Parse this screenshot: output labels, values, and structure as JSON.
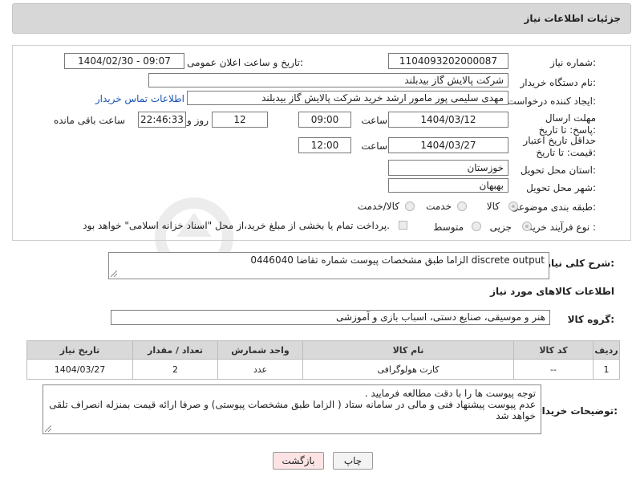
{
  "header": {
    "title": "جزئیات اطلاعات نیاز"
  },
  "form": {
    "need_number_label": "شماره نیاز:",
    "need_number": "1104093202000087",
    "announce_label": "تاریخ و ساعت اعلان عمومی:",
    "announce_value": "1404/02/30 - 09:07",
    "buyer_org_label": "نام دستگاه خریدار:",
    "buyer_org": "شرکت پالایش گاز بیدبلند",
    "creator_label": "ایجاد کننده درخواست:",
    "creator": "مهدی سلیمی پور مامور ارشد خرید شرکت پالایش گاز بیدبلند",
    "contact_link": "اطلاعات تماس خریدار",
    "reply_deadline_label": "مهلت ارسال پاسخ: تا تاریخ:",
    "reply_date": "1404/03/12",
    "time_label": "ساعت",
    "reply_time": "09:00",
    "days_value": "12",
    "days_label": "روز و",
    "remaining_time": "22:46:33",
    "remaining_label": "ساعت باقی مانده",
    "price_validity_label": "حداقل تاریخ اعتبار قیمت: تا تاریخ:",
    "price_date": "1404/03/27",
    "price_time": "12:00",
    "province_label": "استان محل تحویل:",
    "province": "خوزستان",
    "city_label": "شهر محل تحویل:",
    "city": "بهبهان",
    "category_label": "طبقه بندی موضوعی:",
    "category_options": [
      "کالا",
      "خدمت",
      "کالا/خدمت"
    ],
    "process_label": "نوع فرآیند خرید :",
    "process_options": [
      "جزیی",
      "متوسط"
    ],
    "payment_note": "پرداخت تمام یا بخشی از مبلغ خرید،از محل \"اسناد خزانه اسلامی\" خواهد بود."
  },
  "description": {
    "label": "شرح کلی نیاز:",
    "text": "discrete output  الزاما طبق مشخصات پیوست شماره تقاضا 0446040"
  },
  "goods": {
    "section_title": "اطلاعات کالاهای مورد نیاز",
    "group_label": "گروه کالا:",
    "group_value": "هنر و موسیقی، صنایع دستی، اسباب بازی و آموزشی",
    "columns": [
      "ردیف",
      "کد کالا",
      "نام کالا",
      "واحد شمارش",
      "تعداد / مقدار",
      "تاریخ نیاز"
    ],
    "rows": [
      {
        "row": "1",
        "code": "--",
        "name": "کارت هولوگرافی",
        "unit": "عدد",
        "qty": "2",
        "date": "1404/03/27"
      }
    ]
  },
  "buyer_notes": {
    "label": "توضیحات خریدار:",
    "line1": "توجه پیوست ها  را با دقت مطالعه فرمایید .",
    "line2": "عدم پیوست پیشنهاد فنی و مالی در سامانه ستاد ( الزاما طبق مشخصات پیوستی)  و صرفا ارائه قیمت بمنزله انصراف تلقی خواهد شد"
  },
  "buttons": {
    "print": "چاپ",
    "back": "بازگشت"
  },
  "colors": {
    "header_bg": "#d7d7d7",
    "link": "#1a55b5",
    "back_button_bg": "#fde3e3"
  }
}
